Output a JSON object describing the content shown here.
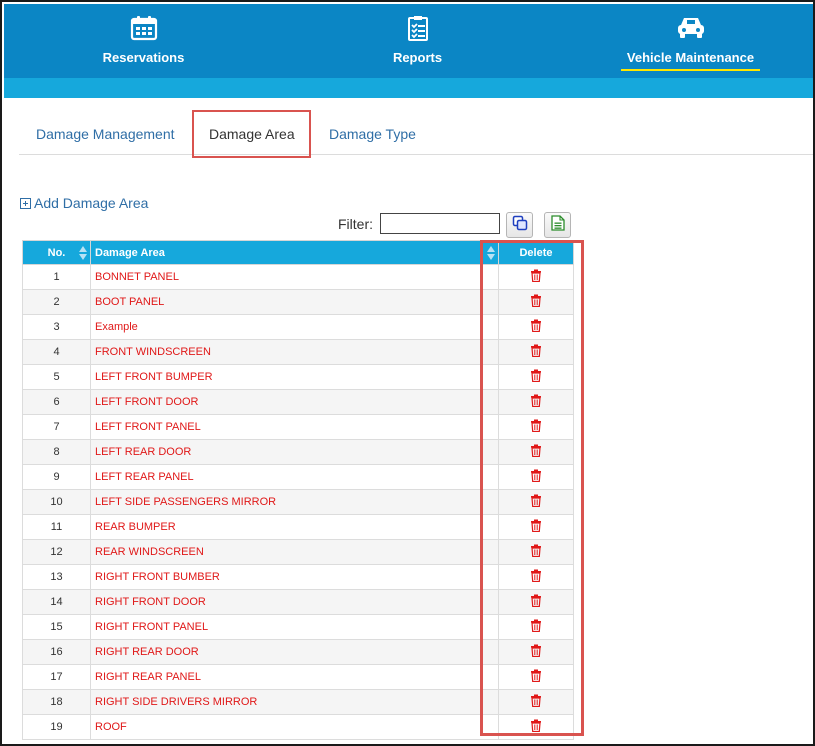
{
  "nav": {
    "items": [
      {
        "label": "Reservations",
        "icon": "calendar-icon"
      },
      {
        "label": "Reports",
        "icon": "checklist-icon"
      },
      {
        "label": "Vehicle Maintenance",
        "icon": "car-icon"
      }
    ],
    "active": "Vehicle Maintenance"
  },
  "tabs": [
    {
      "label": "Damage Management"
    },
    {
      "label": "Damage Area"
    },
    {
      "label": "Damage Type"
    }
  ],
  "active_tab": "Damage Area",
  "toolbar": {
    "add_label": "Add Damage Area",
    "filter_label": "Filter:",
    "filter_value": "",
    "copy_icon": "copy-icon",
    "export_icon": "excel-export-icon"
  },
  "table": {
    "headers": {
      "no": "No.",
      "area": "Damage Area",
      "delete": "Delete"
    },
    "rows": [
      {
        "no": "1",
        "area": "BONNET PANEL"
      },
      {
        "no": "2",
        "area": "BOOT PANEL"
      },
      {
        "no": "3",
        "area": "Example"
      },
      {
        "no": "4",
        "area": "FRONT WINDSCREEN"
      },
      {
        "no": "5",
        "area": "LEFT FRONT BUMPER"
      },
      {
        "no": "6",
        "area": "LEFT FRONT DOOR"
      },
      {
        "no": "7",
        "area": "LEFT FRONT PANEL"
      },
      {
        "no": "8",
        "area": "LEFT REAR DOOR"
      },
      {
        "no": "9",
        "area": "LEFT REAR PANEL"
      },
      {
        "no": "10",
        "area": "LEFT SIDE PASSENGERS MIRROR"
      },
      {
        "no": "11",
        "area": "REAR BUMPER"
      },
      {
        "no": "12",
        "area": "REAR WINDSCREEN"
      },
      {
        "no": "13",
        "area": "RIGHT FRONT BUMBER"
      },
      {
        "no": "14",
        "area": "RIGHT FRONT DOOR"
      },
      {
        "no": "15",
        "area": "RIGHT FRONT PANEL"
      },
      {
        "no": "16",
        "area": "RIGHT REAR DOOR"
      },
      {
        "no": "17",
        "area": "RIGHT REAR PANEL"
      },
      {
        "no": "18",
        "area": "RIGHT SIDE DRIVERS MIRROR"
      },
      {
        "no": "19",
        "area": "ROOF"
      }
    ]
  },
  "colors": {
    "nav_bg": "#0b86c5",
    "header_bg": "#16a8dc",
    "highlight": "#d9534f",
    "area_text": "#e01818",
    "active_underline": "#ffe600"
  }
}
